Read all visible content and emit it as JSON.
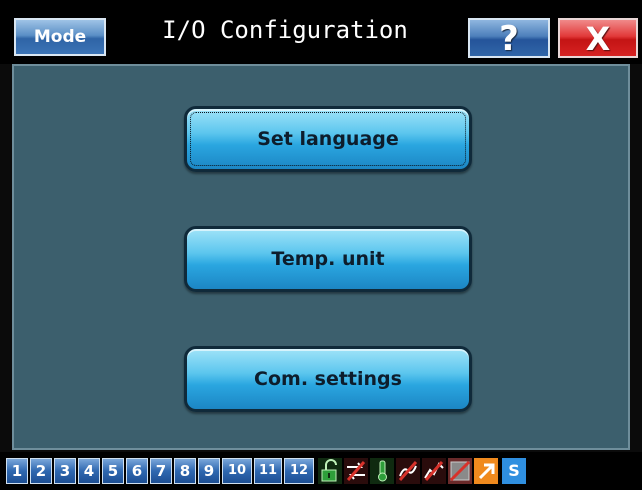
{
  "header": {
    "mode_label": "Mode",
    "title": "I/O Configuration",
    "help_label": "?",
    "close_label": "X"
  },
  "menu": {
    "items": [
      {
        "label": "Set language"
      },
      {
        "label": "Temp. unit"
      },
      {
        "label": "Com. settings"
      }
    ]
  },
  "statusbar": {
    "slots": [
      "1",
      "2",
      "3",
      "4",
      "5",
      "6",
      "7",
      "8",
      "9",
      "10",
      "11",
      "12"
    ],
    "icons": [
      {
        "name": "lock-open-icon",
        "color": "#2e9e3a"
      },
      {
        "name": "swap-arrows-icon",
        "color": "#d8322b"
      },
      {
        "name": "thermometer-icon",
        "color": "#2e9e3a"
      },
      {
        "name": "link-broken-icon",
        "color": "#d8322b"
      },
      {
        "name": "signal-icon",
        "color": "#d8322b"
      },
      {
        "name": "trend-disabled-icon",
        "color": "#d8322b"
      },
      {
        "name": "arrow-up-right-icon",
        "color": "#f08a1e"
      },
      {
        "name": "s-badge-icon",
        "color": "#2f8fe0",
        "label": "S"
      }
    ]
  }
}
